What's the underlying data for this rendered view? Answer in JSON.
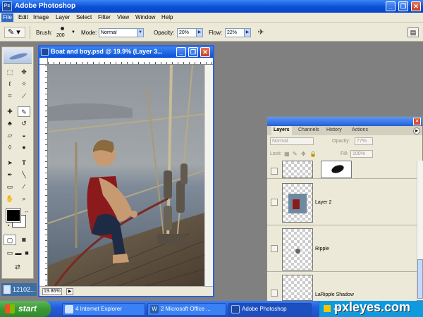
{
  "app": {
    "title": "Adobe Photoshop",
    "icon": "photoshop-app-icon",
    "window_buttons": {
      "minimize": "_",
      "restore": "❐",
      "close": "✕"
    }
  },
  "menu": [
    "File",
    "Edit",
    "Image",
    "Layer",
    "Select",
    "Filter",
    "View",
    "Window",
    "Help"
  ],
  "options_bar": {
    "brush_label": "Brush:",
    "brush_size": "200",
    "mode_label": "Mode:",
    "mode_value": "Normal",
    "opacity_label": "Opacity:",
    "opacity_value": "20%",
    "flow_label": "Flow:",
    "flow_value": "22%"
  },
  "document": {
    "title": "Boat and boy.psd @ 19.9% (Layer 3...",
    "zoom": "19.86%",
    "buttons": {
      "minimize": "_",
      "restore": "❐",
      "close": "✕"
    }
  },
  "layers_palette": {
    "tabs": [
      "Layers",
      "Channels",
      "History",
      "Actions"
    ],
    "blend_mode": "Normal",
    "opacity_label": "Opacity:",
    "opacity_value": "77%",
    "lock_label": "Lock:",
    "fill_label": "Fill:",
    "fill_value": "100%",
    "layers": [
      {
        "name": "",
        "has_mask": true
      },
      {
        "name": "Layer 2"
      },
      {
        "name": "Ripple"
      },
      {
        "name": "LaRipple  Shadow"
      }
    ]
  },
  "taskbar": {
    "start_label": "start",
    "tasks": [
      {
        "label": "4 Internet Explorer"
      },
      {
        "label": "2 Microsoft Office ..."
      },
      {
        "label": "Adobe Photoshop"
      }
    ],
    "watermark": "pxleyes.com"
  },
  "desktop_icon_label": "12102...",
  "colors": {
    "title_blue": "#0a4fd6",
    "menu_bg": "#ece9d8",
    "workspace_gray": "#808080",
    "taskbar_blue": "#245edb",
    "start_green": "#3a9a35"
  }
}
